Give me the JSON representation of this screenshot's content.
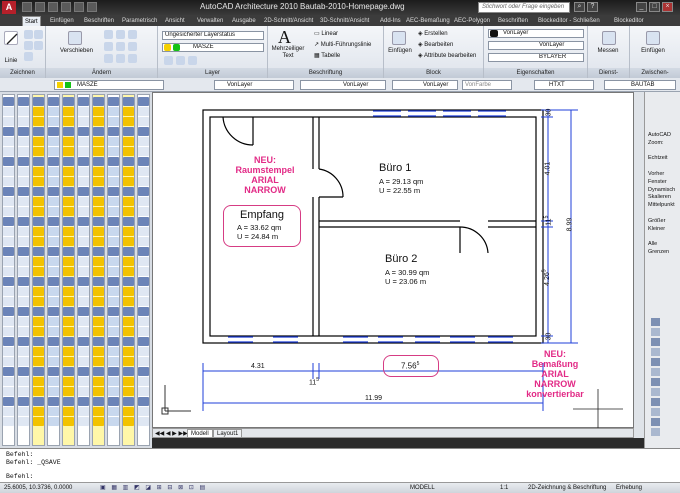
{
  "window": {
    "title": "AutoCAD Architecture 2010   Bautab-2010-Homepage.dwg",
    "search_placeholder": "Stichwort oder Frage eingeben",
    "logo": "A"
  },
  "tabs": [
    "Start",
    "Einfügen",
    "Beschriften",
    "Parametrisch",
    "Ansicht",
    "Verwalten",
    "Ausgabe",
    "2D-Schnitt/Ansicht",
    "3D-Schnitt/Ansicht",
    "Add-Ins",
    "AEC-Bemaßung",
    "AEC-Polygon",
    "Beschriften",
    "Blockeditor - Schließen",
    "Blockeditor"
  ],
  "ribbon": {
    "zeichnen": {
      "title": "Zeichnen",
      "linie": "Linie"
    },
    "aendern": {
      "title": "Ändern",
      "verschieben": "Verschieben"
    },
    "layer": {
      "title": "Layer",
      "state": "Ungesicherter Layerstatus",
      "current": "MASZE"
    },
    "beschriftung": {
      "title": "Beschriftung",
      "text": "Mehrzeiliger Text",
      "linear": "Linear",
      "multi": "Multi-Führungslinie",
      "tabelle": "Tabelle"
    },
    "block": {
      "title": "Block",
      "einfuegen": "Einfügen",
      "erstellen": "Erstellen",
      "bearbeiten": "Bearbeiten",
      "attribute": "Attribute bearbeiten"
    },
    "eigenschaften": {
      "title": "Eigenschaften",
      "color": "VonLayer",
      "linetype": "VonLayer",
      "lineweight": "BYLAYER"
    },
    "dienst": {
      "title": "Dienst-",
      "messen": "Messen"
    },
    "zwischen": {
      "title": "Zwischen-",
      "einfuegen": "Einfügen"
    }
  },
  "propbar": {
    "layer": "MASZE",
    "color": "VonLayer",
    "linetype": "VonLayer",
    "lineweight": "VonLayer",
    "plotstyle": "VonFarbe",
    "textstyle": "HTXT",
    "dimstyle": "BAUTAB"
  },
  "drawing": {
    "rooms": [
      {
        "name": "Empfang",
        "area": "A = 33.62 qm",
        "perimeter": "U = 24.84 m"
      },
      {
        "name": "Büro 1",
        "area": "A = 29.13 qm",
        "perimeter": "U = 22.55 m"
      },
      {
        "name": "Büro 2",
        "area": "A = 30.99 qm",
        "perimeter": "U = 23.06 m"
      }
    ],
    "dims_bottom": {
      "d1": "4.31",
      "d2": "11",
      "d2sup": "5",
      "d3": "7.56",
      "d3sup": "5",
      "total": "11.99"
    },
    "dims_right": {
      "d1": "30",
      "d2": "4.01",
      "d3": "11",
      "d3sup": "5",
      "d4": "4.26",
      "d4sup": "5",
      "d5": "30",
      "total": "8.99"
    },
    "note1": "NEU:\nRaumstempel\nARIAL\nNARROW",
    "note2": "NEU:\nBemaßung\nARIAL\nNARROW\nkonvertierbar"
  },
  "layouts": [
    "Modell",
    "Layout1"
  ],
  "rightpanel": [
    "AutoCAD",
    "Zoom:",
    "",
    "Echtzeit",
    "",
    "Vorher",
    "Fenster",
    "Dynamisch",
    "Skalieren",
    "Mittelpunkt",
    "",
    "Größer",
    "Kleiner",
    "",
    "Alle",
    "Grenzen"
  ],
  "command": [
    "Befehl:",
    "Befehl:  _QSAVE",
    "",
    "Befehl:"
  ],
  "status": {
    "coords": "25.6005, 10.3736, 0.0000",
    "modell": "MODELL",
    "scale": "1:1",
    "workspace": "2D-Zeichnung & Beschriftung",
    "detail": "Erhebung"
  },
  "colors": {
    "accent": "#e22a86",
    "wall": "#000000",
    "window": "#1f3fd8",
    "dim": "#1f3fd8"
  }
}
